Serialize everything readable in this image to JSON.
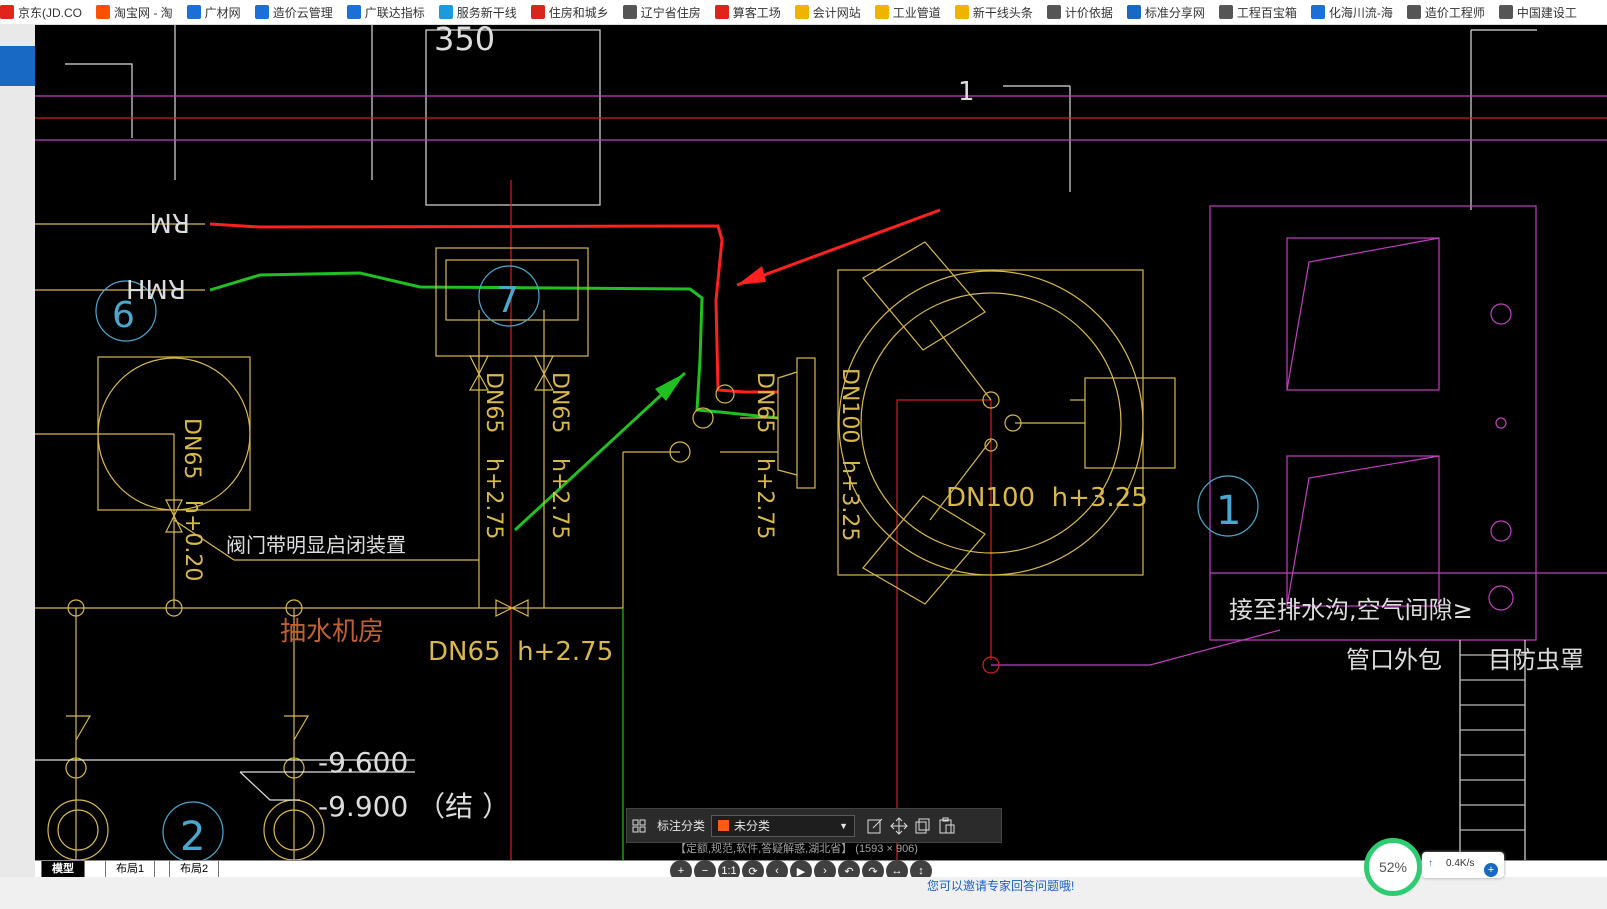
{
  "bookmarks": [
    {
      "label": "京东(JD.CO",
      "icon": "jd-icon",
      "color": "#e1251b"
    },
    {
      "label": "淘宝网 - 淘",
      "icon": "taobao-icon",
      "color": "#ff5000"
    },
    {
      "label": "广材网",
      "icon": "guangcai-icon",
      "color": "#1a6fd8"
    },
    {
      "label": "造价云管理",
      "icon": "zaojiayun-icon",
      "color": "#1a6fd8"
    },
    {
      "label": "广联达指标",
      "icon": "glodon-icon",
      "color": "#1a6fd8"
    },
    {
      "label": "服务新干线",
      "icon": "service-icon",
      "color": "#1a9be0"
    },
    {
      "label": "住房和城乡",
      "icon": "emblem-icon",
      "color": "#d7261b"
    },
    {
      "label": "辽宁省住房",
      "icon": "globe-icon",
      "color": "#555555"
    },
    {
      "label": "算客工场",
      "icon": "suanke-icon",
      "color": "#e0231b"
    },
    {
      "label": "会计网站",
      "icon": "folder-icon",
      "color": "#f0b400"
    },
    {
      "label": "工业管道",
      "icon": "folder-icon",
      "color": "#f0b400"
    },
    {
      "label": "新干线头条",
      "icon": "folder-icon",
      "color": "#f0b400"
    },
    {
      "label": "计价依据",
      "icon": "globe-icon",
      "color": "#555555"
    },
    {
      "label": "标准分享网",
      "icon": "standard-icon",
      "color": "#1769c4"
    },
    {
      "label": "工程百宝箱",
      "icon": "globe-icon",
      "color": "#555555"
    },
    {
      "label": "化海川流-海",
      "icon": "huahai-icon",
      "color": "#1a6fd8"
    },
    {
      "label": "造价工程师",
      "icon": "globe-icon",
      "color": "#555555"
    },
    {
      "label": "中国建设工",
      "icon": "globe-icon",
      "color": "#555555"
    }
  ],
  "cad": {
    "text_350": "350",
    "text_1": "1",
    "rm": "RM",
    "rmh": "RMH",
    "circle_6": "6",
    "circle_7": "7",
    "circle_1": "1",
    "circle_2": "2",
    "dn65": "DN65",
    "dn100": "DN100",
    "h275": "h+2.75",
    "h325": "h+3.25",
    "h020": "h+0.20",
    "valve_note": "阀门带明显启闭装置",
    "room": "抽水机房",
    "dn65_main": "DN65  h+2.75",
    "dn100_main": "DN100  h+3.25",
    "elev1": "-9.600",
    "elev2": "-9.900 （结 ）",
    "drain1": "接至排水沟,空气间隙≥",
    "drain2": "管口外包",
    "drain3": "目防虫罩"
  },
  "tabs": {
    "model": "模型",
    "layout1": "布局1",
    "layout2": "布局2"
  },
  "toolbar": {
    "label": "标注分类",
    "category": "未分类",
    "category_color": "#ff5a14"
  },
  "image_info": "【定额,规范,软件,答疑解惑,湖北省】 (1593 × 906)",
  "viewer_buttons": [
    "+",
    "−",
    "1:1",
    "⟳",
    "‹",
    "▶",
    "›",
    "↶",
    "↷",
    "↔",
    "↕"
  ],
  "bottom_link": "您可以邀请专家回答问题哦!",
  "gauge": "52%",
  "net_speed": "0.4K/s"
}
